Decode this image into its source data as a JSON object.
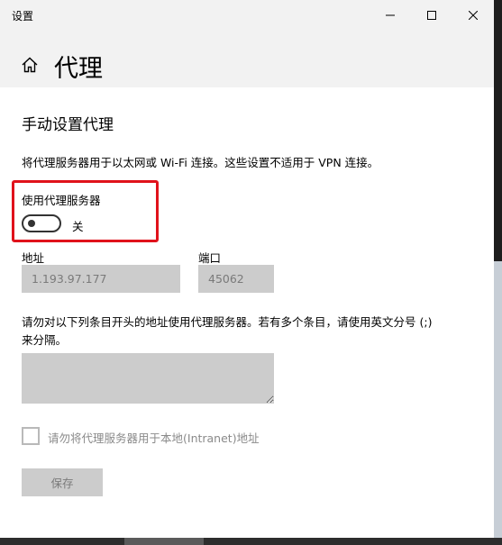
{
  "window": {
    "title": "设置"
  },
  "header": {
    "title": "代理"
  },
  "manual_proxy": {
    "section_title": "手动设置代理",
    "description": "将代理服务器用于以太网或 Wi-Fi 连接。这些设置不适用于 VPN 连接。",
    "toggle": {
      "label": "使用代理服务器",
      "state_text": "关",
      "on": false
    },
    "address": {
      "label": "地址",
      "value": "1.193.97.177"
    },
    "port": {
      "label": "端口",
      "value": "45062"
    },
    "exceptions": {
      "hint": "请勿对以下列条目开头的地址使用代理服务器。若有多个条目，请使用英文分号 (;) 来分隔。",
      "value": ""
    },
    "local_bypass": {
      "label": "请勿将代理服务器用于本地(Intranet)地址",
      "checked": false
    },
    "save_label": "保存"
  },
  "colors": {
    "highlight": "#e0121b",
    "disabled_field": "#cccccc",
    "header_bg": "#f2f2f2"
  }
}
